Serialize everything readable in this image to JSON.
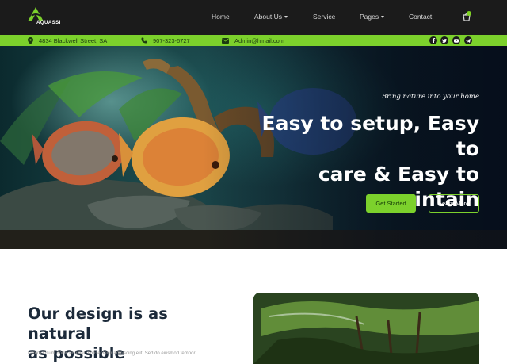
{
  "brand": {
    "name": "AQUASSI"
  },
  "nav": {
    "items": [
      {
        "label": "Home",
        "dropdown": false
      },
      {
        "label": "About Us",
        "dropdown": true
      },
      {
        "label": "Service",
        "dropdown": false
      },
      {
        "label": "Pages",
        "dropdown": true
      },
      {
        "label": "Contact",
        "dropdown": false
      }
    ]
  },
  "infobar": {
    "address": "4834 Blackwell Street, SA",
    "phone": "907-323-6727",
    "email": "Admin@hmail.com",
    "social_icons": [
      "facebook-icon",
      "twitter-icon",
      "youtube-icon",
      "telegram-icon"
    ]
  },
  "hero": {
    "eyebrow": "Bring nature into your home",
    "headline_line1": "Easy to setup, Easy to",
    "headline_line2": "care & Easy to",
    "headline_line3": "maintain",
    "primary_button": "Get Started",
    "secondary_button": "Learn More"
  },
  "section": {
    "title_line1": "Our design is as natural",
    "title_line2": "as possible",
    "body": "Lorem ipsum dolor sit amet, consectetur adipiscing elit. Sed do eiusmod tempor"
  },
  "colors": {
    "accent": "#7cd12c",
    "header_bg": "#1b1b1b",
    "heading": "#1c2a3a"
  }
}
